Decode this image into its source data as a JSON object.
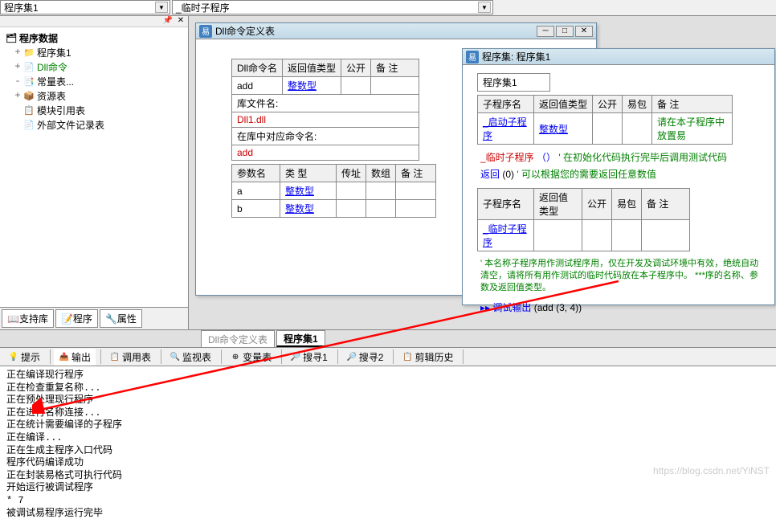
{
  "top": {
    "dd1": "程序集1",
    "dd2": "_临时子程序"
  },
  "tree": {
    "title": "程序数据",
    "items": [
      {
        "icon": "📁",
        "label": "程序集1",
        "exp": "+"
      },
      {
        "icon": "📄",
        "label": "Dll命令",
        "exp": "+",
        "color": "#008000"
      },
      {
        "icon": "📑",
        "label": "常量表...",
        "exp": "-"
      },
      {
        "icon": "📦",
        "label": "资源表",
        "exp": "+"
      },
      {
        "icon": "📋",
        "label": "模块引用表",
        "exp": ""
      },
      {
        "icon": "📄",
        "label": "外部文件记录表",
        "exp": ""
      }
    ]
  },
  "leftTabs": [
    {
      "icon": "📖",
      "label": "支持库"
    },
    {
      "icon": "📝",
      "label": "程序"
    },
    {
      "icon": "🔧",
      "label": "属性"
    }
  ],
  "dllWindow": {
    "title": "Dll命令定义表",
    "headers1": [
      "Dll命令名",
      "返回值类型",
      "公开",
      "备 注"
    ],
    "row1": {
      "name": "add",
      "type": "整数型"
    },
    "libFileLabel": "库文件名:",
    "libFile": "Dll1.dll",
    "libCmdLabel": "在库中对应命令名:",
    "libCmd": "add",
    "paramHeaders": [
      "参数名",
      "类 型",
      "传址",
      "数组",
      "备 注"
    ],
    "params": [
      {
        "name": "a",
        "type": "整数型"
      },
      {
        "name": "b",
        "type": "整数型"
      }
    ]
  },
  "progWindow": {
    "title": "程序集: 程序集1",
    "setName": "程序集1",
    "subHeaders": [
      "子程序名",
      "返回值类型",
      "公开",
      "易包",
      "备 注"
    ],
    "startup": {
      "name": "_启动子程序",
      "type": "整数型",
      "note": "请在本子程序中放置易"
    },
    "tempLine": "_临时子程序",
    "tempParen": "（）",
    "tempComment": "' 在初始化代码执行完毕后调用测试代码",
    "retLine": "返回",
    "retVal": "(0)",
    "retComment": "' 可以根据您的需要返回任意数值",
    "temp": {
      "name": "_临时子程序"
    },
    "greenComment": "'  本名称子程序用作测试程序用，仅在开发及调试环境中有效，绝统自动清空，请将所有用作测试的临时代码放在本子程序中。 ***序的名称、参数及返回值类型。",
    "debugMarker": "▸▸",
    "debugOut": "调试输出",
    "debugArgs": "(add (3, 4))"
  },
  "editorTabs": [
    {
      "label": "Dll命令定义表",
      "active": false
    },
    {
      "label": "程序集1",
      "active": true
    }
  ],
  "bottomTabs": [
    {
      "icon": "💡",
      "label": "提示"
    },
    {
      "icon": "📤",
      "label": "输出",
      "active": true
    },
    {
      "icon": "📋",
      "label": "调用表"
    },
    {
      "icon": "🔍",
      "label": "监视表"
    },
    {
      "icon": "⊕",
      "label": "变量表"
    },
    {
      "icon": "🔎",
      "label": "搜寻1"
    },
    {
      "icon": "🔎",
      "label": "搜寻2"
    },
    {
      "icon": "📋",
      "label": "剪辑历史"
    }
  ],
  "output": [
    "正在编译现行程序",
    "正在检查重复名称...",
    "正在预处理现行程序",
    "正在进行名称连接...",
    "正在统计需要编译的子程序",
    "正在编译...",
    "正在生成主程序入口代码",
    "程序代码编译成功",
    "正在封装易格式可执行代码",
    "开始运行被调试程序",
    "* 7",
    "被调试易程序运行完毕"
  ],
  "watermark": "https://blog.csdn.net/YiNST"
}
